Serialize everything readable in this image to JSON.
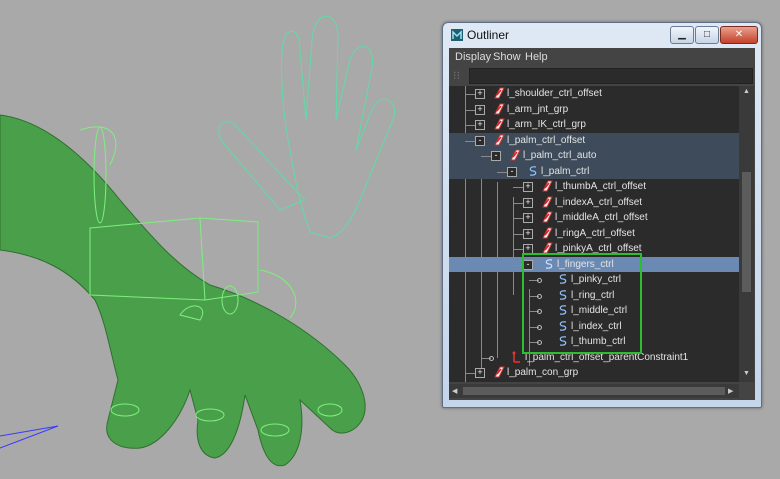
{
  "window": {
    "title": "Outliner"
  },
  "menu": [
    "Display",
    "Show",
    "Help"
  ],
  "tree": [
    {
      "label": "l_shoulder_ctrl_offset",
      "type": "group",
      "expander": "+"
    },
    {
      "label": "l_arm_jnt_grp",
      "type": "group",
      "expander": "+"
    },
    {
      "label": "l_arm_IK_ctrl_grp",
      "type": "group",
      "expander": "+"
    },
    {
      "label": "l_palm_ctrl_offset",
      "type": "group",
      "expander": "-"
    },
    {
      "label": "l_palm_ctrl_auto",
      "type": "group",
      "expander": "-"
    },
    {
      "label": "l_palm_ctrl",
      "type": "curve",
      "expander": "-"
    },
    {
      "label": "l_thumbA_ctrl_offset",
      "type": "group",
      "expander": "+"
    },
    {
      "label": "l_indexA_ctrl_offset",
      "type": "group",
      "expander": "+"
    },
    {
      "label": "l_middleA_ctrl_offset",
      "type": "group",
      "expander": "+"
    },
    {
      "label": "l_ringA_ctrl_offset",
      "type": "group",
      "expander": "+"
    },
    {
      "label": "l_pinkyA_ctrl_offset",
      "type": "group",
      "expander": "+"
    },
    {
      "label": "l_fingers_ctrl",
      "type": "curve",
      "expander": "-"
    },
    {
      "label": "l_pinky_ctrl",
      "type": "curve",
      "expander": ""
    },
    {
      "label": "l_ring_ctrl",
      "type": "curve",
      "expander": ""
    },
    {
      "label": "l_middle_ctrl",
      "type": "curve",
      "expander": ""
    },
    {
      "label": "l_index_ctrl",
      "type": "curve",
      "expander": ""
    },
    {
      "label": "l_thumb_ctrl",
      "type": "curve",
      "expander": ""
    },
    {
      "label": "l_palm_ctrl_offset_parentConstraint1",
      "type": "constraint",
      "expander": ""
    },
    {
      "label": "l_palm_con_grp",
      "type": "group",
      "expander": "+"
    }
  ],
  "colors": {
    "selection": "#6b8ab3",
    "highlight_box": "#2bc02b",
    "mesh": "#4aa04a",
    "wire": "#4fe0a8"
  }
}
